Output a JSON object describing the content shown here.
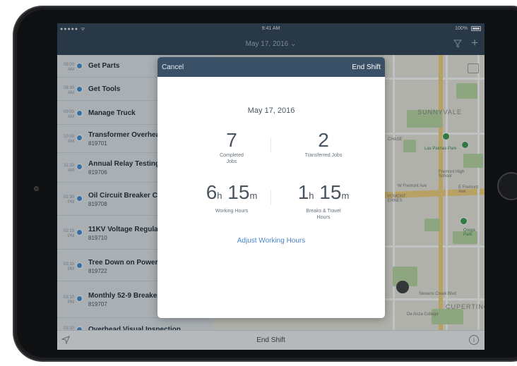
{
  "status": {
    "carrier": "●●●●● ᯤ",
    "time": "9:41 AM",
    "battery": "100%"
  },
  "nav": {
    "title": "May 17, 2016 ⌄"
  },
  "map": {
    "labels": [
      "SUNNYVALE",
      "CUPERTINO",
      "Las Palmas Park",
      "Fremont High School",
      "W Fremont Ave",
      "E Fremont Ave",
      "Orega Park",
      "Stevens Creek Blvd",
      "De Anza College",
      "CHASE",
      "HTMONT ERNES",
      "Sunnyvale Saratoga Rd",
      "N De Anza Blvd",
      "N Blaney Ave"
    ],
    "shields": [
      "82",
      "82",
      "280",
      "85"
    ]
  },
  "jobs": [
    {
      "time": "08:00",
      "ampm": "AM",
      "name": "Get Parts",
      "num": ""
    },
    {
      "time": "08:30",
      "ampm": "AM",
      "name": "Get Tools",
      "num": ""
    },
    {
      "time": "09:00",
      "ampm": "AM",
      "name": "Manage Truck",
      "num": ""
    },
    {
      "time": "10:00",
      "ampm": "AM",
      "name": "Transformer Overhea",
      "num": "819701"
    },
    {
      "time": "11:30",
      "ampm": "AM",
      "name": "Annual Relay Testing",
      "num": "819706"
    },
    {
      "time": "01:30",
      "ampm": "PM",
      "name": "Oil Circuit Breaker Cl",
      "num": "819708"
    },
    {
      "time": "02:15",
      "ampm": "PM",
      "name": "11KV Voltage Regulat",
      "num": "819710"
    },
    {
      "time": "03:10",
      "ampm": "PM",
      "name": "Tree Down on Powerl",
      "num": "819722"
    },
    {
      "time": "03:10",
      "ampm": "PM",
      "name": "Monthly 52-9 Breake",
      "num": "819707"
    },
    {
      "time": "03:10",
      "ampm": "PM",
      "name": "Overhead Visual Inspection",
      "num": ""
    }
  ],
  "toolbar": {
    "end_shift": "End Shift",
    "info": "i"
  },
  "modal": {
    "cancel": "Cancel",
    "end_shift": "End Shift",
    "date": "May 17, 2016",
    "completed": {
      "value": "7",
      "label": "Completed Jobs"
    },
    "transferred": {
      "value": "2",
      "label": "Transferred Jobs"
    },
    "working": {
      "h": "6",
      "hunit": "h",
      "m": "15",
      "munit": "m",
      "label": "Working Hours"
    },
    "breaks": {
      "h": "1",
      "hunit": "h",
      "m": "15",
      "munit": "m",
      "label": "Breaks & Travel Hours"
    },
    "adjust": "Adjust Working Hours"
  },
  "colors": {
    "accent": "#4a86c5",
    "header": "#2e4153",
    "modal_header": "#3a5066",
    "dot": "#3f8fd4"
  }
}
